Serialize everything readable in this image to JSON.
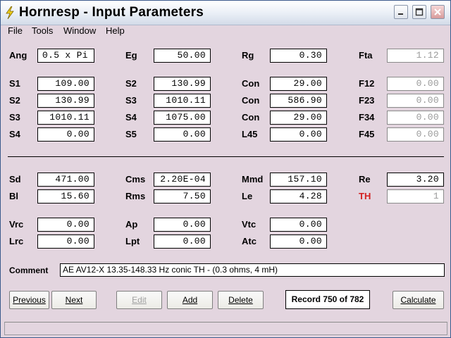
{
  "window": {
    "title": "Hornresp - Input Parameters",
    "icon": "lightning-bolt-icon",
    "controls": [
      "minimize-icon",
      "maximize-icon",
      "close-icon"
    ]
  },
  "menu": [
    "File",
    "Tools",
    "Window",
    "Help"
  ],
  "params": {
    "ang": {
      "label": "Ang",
      "value": "0.5 x Pi"
    },
    "eg": {
      "label": "Eg",
      "value": "50.00"
    },
    "rg": {
      "label": "Rg",
      "value": "0.30"
    },
    "fta": {
      "label": "Fta",
      "value": "1.12"
    },
    "s1": {
      "label": "S1",
      "value": "109.00"
    },
    "s2a": {
      "label": "S2",
      "value": "130.99"
    },
    "con1": {
      "label": "Con",
      "value": "29.00"
    },
    "f12": {
      "label": "F12",
      "value": "0.00"
    },
    "s2b": {
      "label": "S2",
      "value": "130.99"
    },
    "s3a": {
      "label": "S3",
      "value": "1010.11"
    },
    "con2": {
      "label": "Con",
      "value": "586.90"
    },
    "f23": {
      "label": "F23",
      "value": "0.00"
    },
    "s3b": {
      "label": "S3",
      "value": "1010.11"
    },
    "s4a": {
      "label": "S4",
      "value": "1075.00"
    },
    "con3": {
      "label": "Con",
      "value": "29.00"
    },
    "f34": {
      "label": "F34",
      "value": "0.00"
    },
    "s4b": {
      "label": "S4",
      "value": "0.00"
    },
    "s5": {
      "label": "S5",
      "value": "0.00"
    },
    "l45": {
      "label": "L45",
      "value": "0.00"
    },
    "f45": {
      "label": "F45",
      "value": "0.00"
    },
    "sd": {
      "label": "Sd",
      "value": "471.00"
    },
    "cms": {
      "label": "Cms",
      "value": "2.20E-04"
    },
    "mmd": {
      "label": "Mmd",
      "value": "157.10"
    },
    "re": {
      "label": "Re",
      "value": "3.20"
    },
    "bl": {
      "label": "Bl",
      "value": "15.60"
    },
    "rms": {
      "label": "Rms",
      "value": "7.50"
    },
    "le": {
      "label": "Le",
      "value": "4.28"
    },
    "th": {
      "label": "TH",
      "value": "1"
    },
    "vrc": {
      "label": "Vrc",
      "value": "0.00"
    },
    "ap": {
      "label": "Ap",
      "value": "0.00"
    },
    "vtc": {
      "label": "Vtc",
      "value": "0.00"
    },
    "lrc": {
      "label": "Lrc",
      "value": "0.00"
    },
    "lpt": {
      "label": "Lpt",
      "value": "0.00"
    },
    "atc": {
      "label": "Atc",
      "value": "0.00"
    }
  },
  "comment": {
    "label": "Comment",
    "value": "AE AV12-X 13.35-148.33 Hz conic TH - (0.3 ohms, 4 mH)"
  },
  "buttons": {
    "previous": "Previous",
    "next": "Next",
    "edit": "Edit",
    "add": "Add",
    "delete": "Delete",
    "calculate": "Calculate"
  },
  "record": "Record 750 of 782",
  "colors": {
    "window_bg": "#e3d5df",
    "th_label": "#d32020",
    "disabled_text": "#9a9a9a"
  }
}
